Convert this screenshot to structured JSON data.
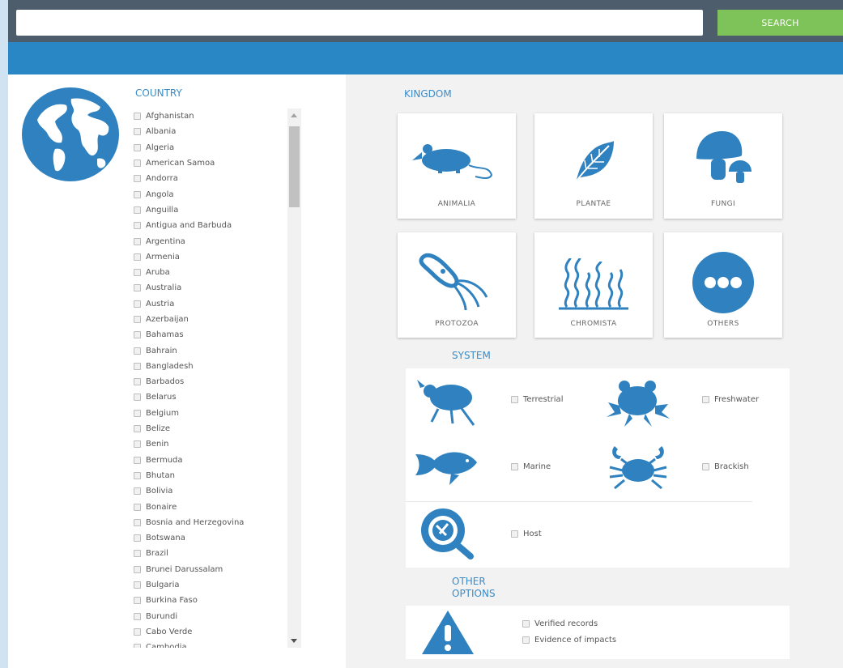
{
  "search": {
    "placeholder": "",
    "value": "",
    "button_label": "SEARCH"
  },
  "country": {
    "title": "COUNTRY",
    "items": [
      "Afghanistan",
      "Albania",
      "Algeria",
      "American Samoa",
      "Andorra",
      "Angola",
      "Anguilla",
      "Antigua and Barbuda",
      "Argentina",
      "Armenia",
      "Aruba",
      "Australia",
      "Austria",
      "Azerbaijan",
      "Bahamas",
      "Bahrain",
      "Bangladesh",
      "Barbados",
      "Belarus",
      "Belgium",
      "Belize",
      "Benin",
      "Bermuda",
      "Bhutan",
      "Bolivia",
      "Bonaire",
      "Bosnia and Herzegovina",
      "Botswana",
      "Brazil",
      "Brunei Darussalam",
      "Bulgaria",
      "Burkina Faso",
      "Burundi",
      "Cabo Verde",
      "Cambodia"
    ]
  },
  "kingdom": {
    "title": "KINGDOM",
    "items": [
      {
        "label": "ANIMALIA",
        "icon": "mouse-icon"
      },
      {
        "label": "PLANTAE",
        "icon": "leaf-icon"
      },
      {
        "label": "FUNGI",
        "icon": "mushroom-icon"
      },
      {
        "label": "PROTOZOA",
        "icon": "protozoa-icon"
      },
      {
        "label": "CHROMISTA",
        "icon": "chromista-icon"
      },
      {
        "label": "OTHERS",
        "icon": "more-dots-icon"
      }
    ]
  },
  "system": {
    "title": "SYSTEM",
    "items": [
      {
        "label": "Terrestrial",
        "icon": "beetle-icon"
      },
      {
        "label": "Freshwater",
        "icon": "frog-icon"
      },
      {
        "label": "Marine",
        "icon": "fish-icon"
      },
      {
        "label": "Brackish",
        "icon": "crab-icon"
      },
      {
        "label": "Host",
        "icon": "host-magnifier-icon"
      }
    ]
  },
  "other_options": {
    "title_line1": "OTHER",
    "title_line2": "OPTIONS",
    "icon": "warning-icon",
    "items": [
      "Verified records",
      "Evidence of impacts"
    ]
  },
  "colors": {
    "accent": "#2887c4",
    "icon_blue": "#2f82bf",
    "search_green": "#7ec35a",
    "topbar": "#4e5d6b"
  }
}
